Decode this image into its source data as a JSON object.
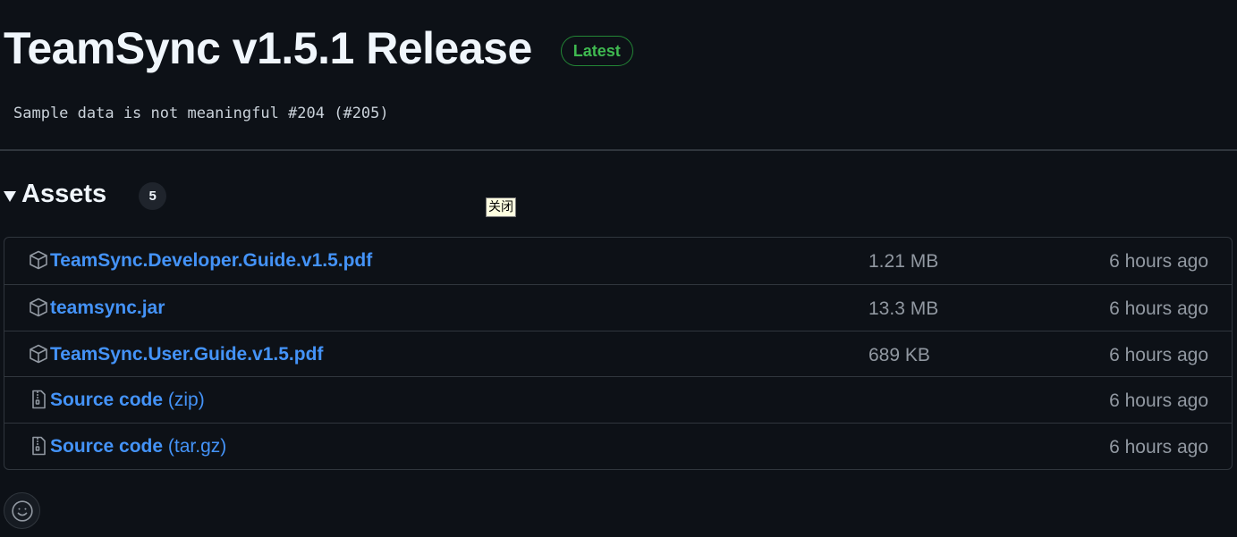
{
  "release": {
    "title": "TeamSync v1.5.1 Release",
    "badge": "Latest",
    "body": "Sample data is not meaningful #204 (#205)"
  },
  "assets": {
    "label": "Assets",
    "count": "5",
    "tooltip": "关闭",
    "items": [
      {
        "icon": "package-icon",
        "name": "TeamSync.Developer.Guide.v1.5.pdf",
        "suffix": "",
        "size": "1.21 MB",
        "time": "6 hours ago"
      },
      {
        "icon": "package-icon",
        "name": "teamsync.jar",
        "suffix": "",
        "size": "13.3 MB",
        "time": "6 hours ago"
      },
      {
        "icon": "package-icon",
        "name": "TeamSync.User.Guide.v1.5.pdf",
        "suffix": "",
        "size": "689 KB",
        "time": "6 hours ago"
      },
      {
        "icon": "file-zip-icon",
        "name": "Source code",
        "suffix": "(zip)",
        "size": "",
        "time": "6 hours ago"
      },
      {
        "icon": "file-zip-icon",
        "name": "Source code",
        "suffix": "(tar.gz)",
        "size": "",
        "time": "6 hours ago"
      }
    ]
  },
  "reaction": {
    "icon": "smiley-icon"
  },
  "colors": {
    "background": "#0d1117",
    "link": "#4493f8",
    "muted": "#9198a1",
    "badge_green": "#3fb950",
    "border": "#30363d"
  }
}
